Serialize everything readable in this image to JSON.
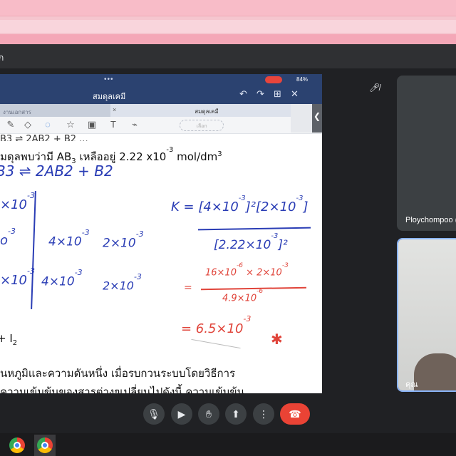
{
  "browser": {
    "window_title": ""
  },
  "meet": {
    "title": "ก",
    "participants": [
      {
        "name": "Ploychompoo (",
        "muted": true
      },
      {
        "name": "คุณ"
      }
    ],
    "controls": {
      "mic": "mic-icon",
      "camera": "camera-icon",
      "hand": "raise-hand-icon",
      "present": "present-icon",
      "more": "more-options-icon",
      "end_call": "end-call-icon"
    },
    "colors": {
      "end_call": "#ea4335",
      "accent": "#8ab4f8"
    }
  },
  "tablet": {
    "status": {
      "dots": "•••",
      "battery": "84%"
    },
    "doc_title": "สมดุลเคมี",
    "tab_left": "งานเอกสาร",
    "tab_right": "สมดุลเคมี",
    "pill": "เลือก",
    "side_handle": "❮"
  },
  "notes": {
    "typed_top": "B3 ⇌ 2AB2 + B2  ...",
    "typed_line2_a": "มดุลพบว่ามี  AB",
    "typed_line2_sub": "3",
    "typed_line2_b": " เหลืออยู่ 2.22 x10",
    "typed_line2_exp": "-3",
    "typed_line2_unit": "  mol/dm",
    "typed_line2_unitexp": "3",
    "typed_i2": "+ I",
    "typed_i2_sub": "2",
    "typed_bottom1": "นหภูมิและความดันหนึ่ง เมื่อรบกวนระบบโดยวิธีการ",
    "typed_bottom2": "ความเข้มข้นของสารต่างๆเปลี่ยนไปดังนี้ ความเข้มข้น",
    "ink_eq": "B3  ⇌  2AB2  +  B2",
    "ink_c1": "×10",
    "ink_c1e": "-3",
    "ink_c2": "o",
    "ink_c2e": "-3",
    "ink_c3": "×10",
    "ink_c3e": "-3",
    "ink_mid1": "4×10",
    "ink_mid1e": "-3",
    "ink_r1": "2×10",
    "ink_r1e": "-3",
    "ink_mid2": "4×10",
    "ink_mid2e": "-3",
    "ink_r2": "2×10",
    "ink_r2e": "-3",
    "ink_K": "K = [4×10",
    "ink_Ke": "-3",
    "ink_K2": "]²[2×10",
    "ink_K2e": "-3",
    "ink_K3": "]",
    "ink_den": "[2.22×10",
    "ink_dene": "-3",
    "ink_den2": "]²",
    "ink_num": "16×10",
    "ink_nume": "-6",
    "ink_num2": " × 2×10",
    "ink_num2e": "-3",
    "ink_den3": "4.9×10",
    "ink_den3e": "-6",
    "ink_eq_sign": "=",
    "ink_result": "= 6.5×10",
    "ink_resulte": "-3"
  }
}
